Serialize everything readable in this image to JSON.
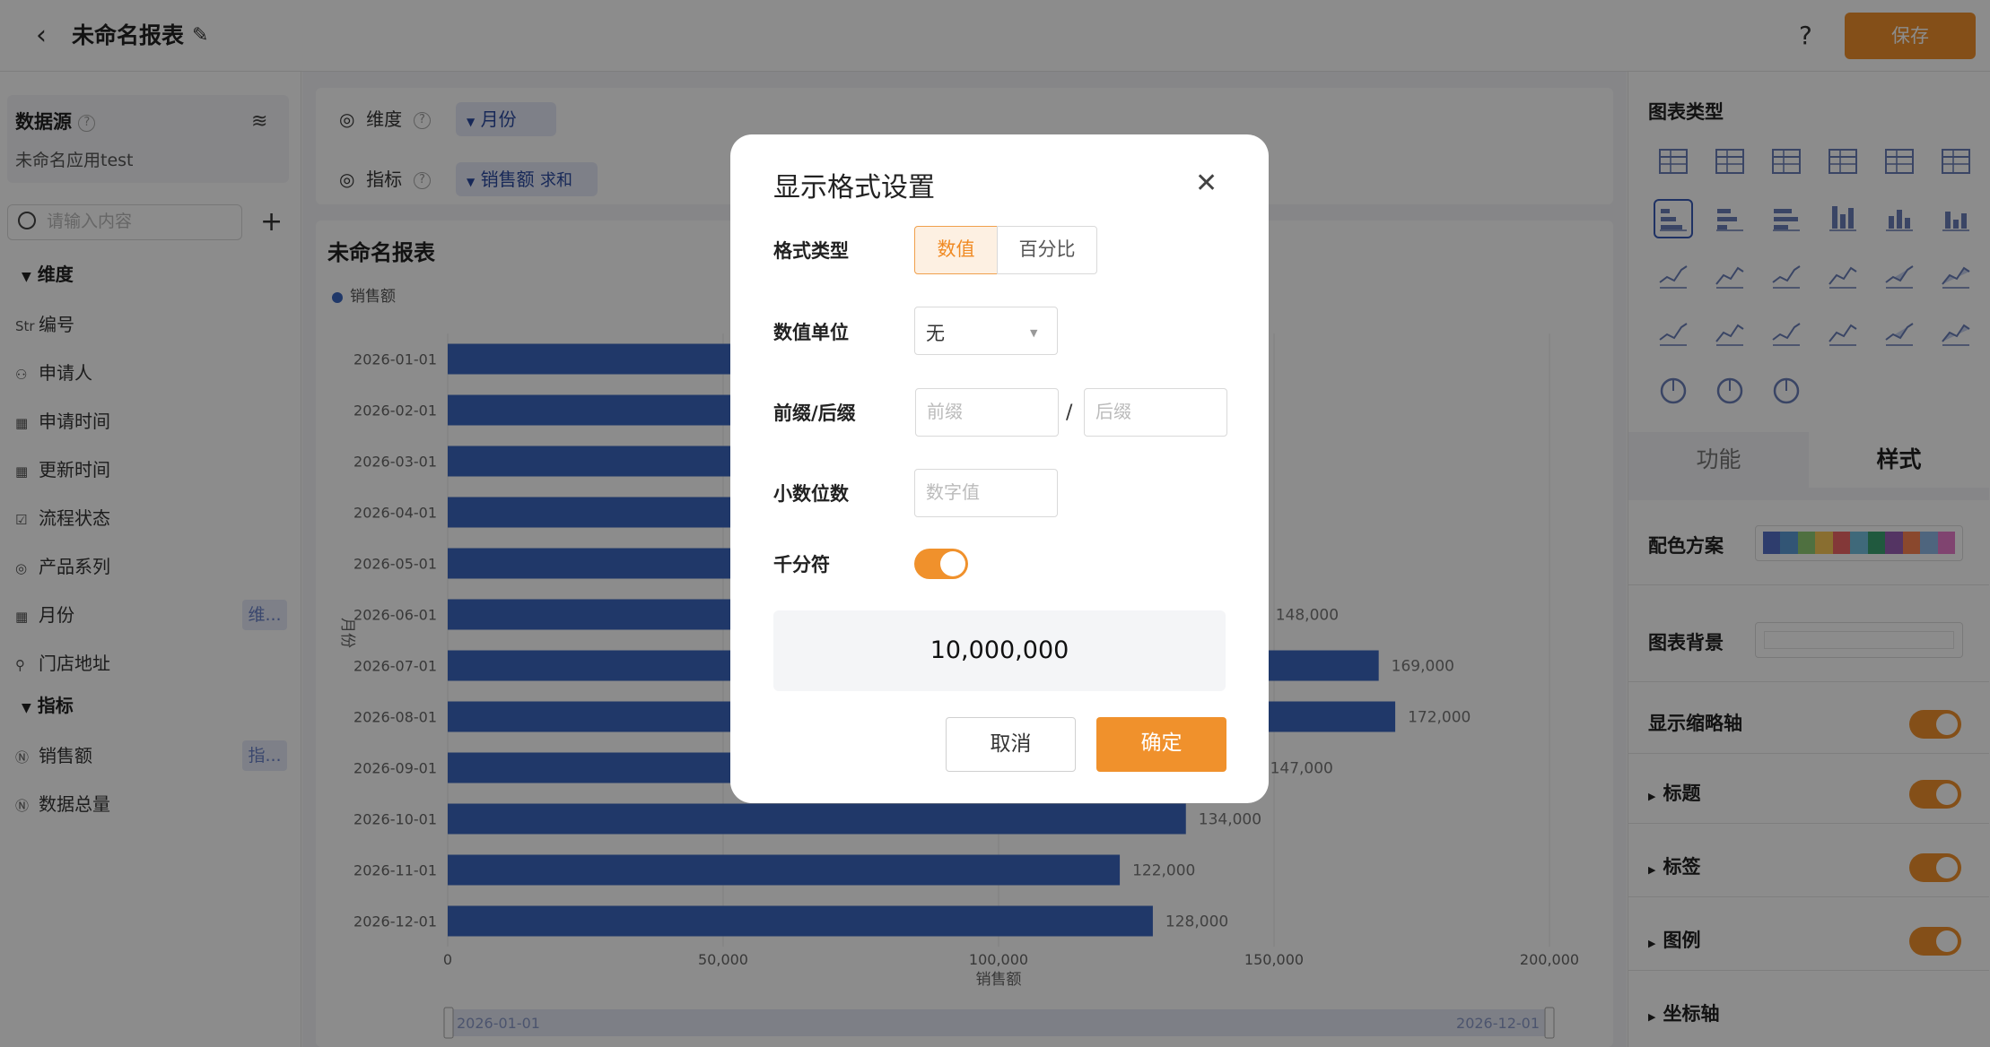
{
  "header": {
    "title": "未命名报表",
    "help": "?",
    "save_label": "保存"
  },
  "left": {
    "datasource_label": "数据源",
    "datasource_name": "未命名应用test",
    "search_placeholder": "请输入内容",
    "dimension_group": "维度",
    "dimension_fields": [
      {
        "type": "Str",
        "label": "编号"
      },
      {
        "type": "user",
        "label": "申请人"
      },
      {
        "type": "date",
        "label": "申请时间"
      },
      {
        "type": "date",
        "label": "更新时间"
      },
      {
        "type": "check",
        "label": "流程状态"
      },
      {
        "type": "radio",
        "label": "产品系列"
      },
      {
        "type": "date",
        "label": "月份",
        "tag": "维..."
      },
      {
        "type": "location",
        "label": "门店地址"
      }
    ],
    "measure_group": "指标",
    "measure_fields": [
      {
        "type": "N",
        "label": "销售额",
        "tag": "指..."
      },
      {
        "type": "N",
        "label": "数据总量"
      }
    ]
  },
  "config": {
    "dimension_label": "维度",
    "dimension_pill": "月份",
    "measure_label": "指标",
    "measure_pill": "销售额",
    "measure_agg": "求和"
  },
  "chart_title": "未命名报表",
  "chart_data": {
    "type": "bar",
    "orientation": "horizontal",
    "categories": [
      "2026-01-01",
      "2026-02-01",
      "2026-03-01",
      "2026-04-01",
      "2026-05-01",
      "2026-06-01",
      "2026-07-01",
      "2026-08-01",
      "2026-09-01",
      "2026-10-01",
      "2026-11-01",
      "2026-12-01"
    ],
    "series": [
      {
        "name": "销售额",
        "values": [
          null,
          null,
          null,
          null,
          null,
          148000,
          169000,
          172000,
          147000,
          134000,
          122000,
          128000
        ]
      }
    ],
    "labels": [
      "",
      "",
      "",
      "",
      "",
      "148,000",
      "169,000",
      "172,000",
      "147,000",
      "134,000",
      "122,000",
      "128,000"
    ],
    "ylabel": "月份",
    "xlabel": "销售额",
    "xticks": [
      "0",
      "50,000",
      "100,000",
      "150,000",
      "200,000"
    ],
    "xlim": [
      0,
      200000
    ],
    "legend_position": "top-left",
    "range_slider": {
      "start": "2026-01-01",
      "end": "2026-12-01"
    },
    "bar_color": "#3b66bf"
  },
  "right_panel": {
    "chart_types_title": "图表类型",
    "tabs": [
      "功能",
      "样式"
    ],
    "active_tab": "样式",
    "props": [
      {
        "label": "配色方案",
        "kind": "palette"
      },
      {
        "label": "图表背景",
        "kind": "color"
      },
      {
        "label": "显示缩略轴",
        "kind": "toggle",
        "on": true
      },
      {
        "label": "标题",
        "kind": "toggle",
        "on": true
      },
      {
        "label": "标签",
        "kind": "toggle",
        "on": true
      },
      {
        "label": "图例",
        "kind": "toggle",
        "on": true
      },
      {
        "label": "坐标轴",
        "kind": "section"
      }
    ],
    "palette": [
      "#5470c6",
      "#5b9bd5",
      "#91cc75",
      "#fac858",
      "#ee6666",
      "#73c0de",
      "#3ba272",
      "#9a60b4",
      "#fc8452",
      "#8fb8e6",
      "#ea7ccc"
    ]
  },
  "dialog": {
    "title": "显示格式设置",
    "format_type_label": "格式类型",
    "format_options": [
      "数值",
      "百分比"
    ],
    "format_selected": "数值",
    "unit_label": "数值单位",
    "unit_value": "无",
    "prefix_suffix_label": "前缀/后缀",
    "prefix_placeholder": "前缀",
    "suffix_placeholder": "后缀",
    "slash": "/",
    "decimal_label": "小数位数",
    "decimal_placeholder": "数字值",
    "thousands_label": "千分符",
    "thousands_on": true,
    "preview": "10,000,000",
    "cancel_label": "取消",
    "confirm_label": "确定"
  },
  "colors": {
    "accent": "#f0912c",
    "primary_blue": "#3b66bf",
    "tag_bg": "#e6eaf7"
  }
}
